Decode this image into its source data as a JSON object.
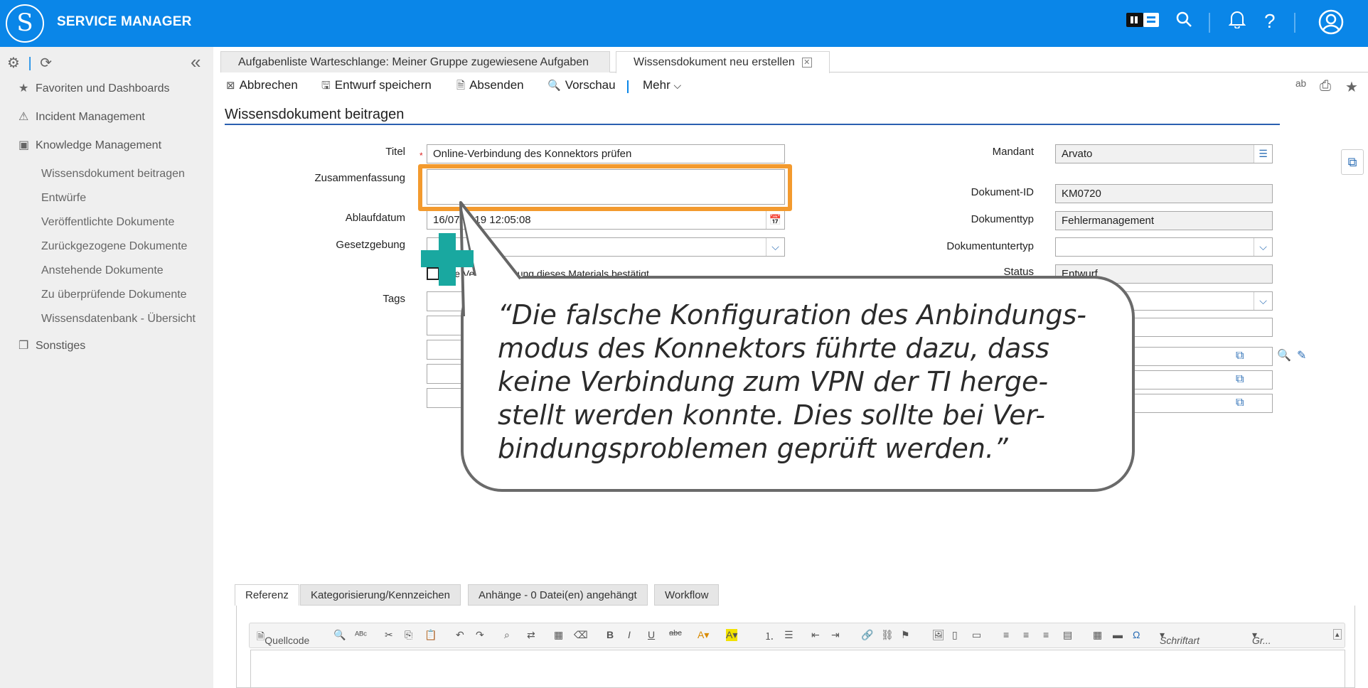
{
  "app": {
    "title": "SERVICE MANAGER",
    "logo_glyph": "S"
  },
  "top_icons": [
    "tenant-switch-icon",
    "search-icon",
    "bell-icon",
    "help-icon",
    "user-icon"
  ],
  "sidebar": {
    "sections": [
      {
        "label": "Favoriten und Dashboards",
        "icon": "star-icon"
      },
      {
        "label": "Incident Management",
        "icon": "warning-icon"
      },
      {
        "label": "Knowledge Management",
        "icon": "book-icon"
      },
      {
        "label": "Sonstiges",
        "icon": "stack-icon"
      }
    ],
    "km_items": [
      "Wissensdokument beitragen",
      "Entwürfe",
      "Veröffentlichte Dokumente",
      "Zurückgezogene Dokumente",
      "Anstehende Dokumente",
      "Zu überprüfende Dokumente",
      "Wissensdatenbank - Übersicht"
    ]
  },
  "tabs": [
    {
      "label": "Aufgabenliste Warteschlange: Meiner Gruppe zugewiesene Aufgaben"
    },
    {
      "label": "Wissensdokument neu erstellen"
    }
  ],
  "toolbar": {
    "cancel": "Abbrechen",
    "save_draft": "Entwurf speichern",
    "submit": "Absenden",
    "preview": "Vorschau",
    "more": "Mehr"
  },
  "page_title": "Wissensdokument beitragen",
  "form": {
    "titel_label": "Titel",
    "titel_value": "Online-Verbindung des Konnektors prüfen",
    "zusammenfassung_label": "Zusammenfassung",
    "zusammenfassung_value": "",
    "ablaufdatum_label": "Ablaufdatum",
    "ablaufdatum_value": "16/07/2019 12:05:08",
    "gesetzgebung_label": "Gesetzgebung",
    "gesetzgebung_value": "",
    "checkbox_label": "Die Veröffentlichung dieses Materials bestätigt",
    "tags_label": "Tags",
    "mandant_label": "Mandant",
    "mandant_value": "Arvato",
    "dokument_id_label": "Dokument-ID",
    "dokument_id_value": "KM0720",
    "dokumenttyp_label": "Dokumenttyp",
    "dokumenttyp_value": "Fehlermanagement",
    "dokumentuntertyp_label": "Dokumentuntertyp",
    "dokumentuntertyp_value": "",
    "status_label": "Status",
    "status_value": "Entwurf"
  },
  "callout": {
    "text": "“Die falsche Konfiguration des Anbindungs-modus des Konnektors führte dazu, dass keine Verbindung zum VPN der TI herge-stellt werden konnte. Dies sollte bei Ver-bindungsproblemen geprüft werden.”",
    "highlight_color": "#f39a2e",
    "plus_color": "#19a8a0"
  },
  "subtabs": [
    "Referenz",
    "Kategorisierung/Kennzeichen",
    "Anhänge  - 0 Datei(en) angehängt",
    "Workflow"
  ],
  "editor": {
    "source_label": "Quellcode",
    "font_select": "Schriftart",
    "size_select": "Gr..."
  },
  "colors": {
    "topbar": "#0a86e8",
    "accent": "#2a5fb0"
  }
}
